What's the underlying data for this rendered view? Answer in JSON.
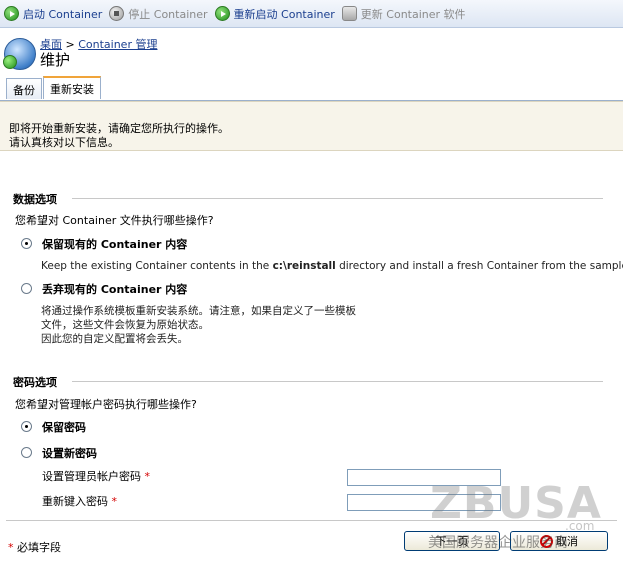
{
  "toolbar": {
    "start": "启动 Container",
    "stop": "停止 Container",
    "restart": "重新启动 Container",
    "update": "更新 Container 软件"
  },
  "breadcrumb": {
    "home": "桌面",
    "sep": ">",
    "container": "Container 管理"
  },
  "page_title": "维护",
  "tabs": {
    "backup": "备份",
    "reinstall": "重新安装"
  },
  "notice": {
    "line1": "即将开始重新安装，请确定您所执行的操作。",
    "line2": "请认真核对以下信息。"
  },
  "data_options": {
    "title": "数据选项",
    "question": "您希望对 Container 文件执行哪些操作?",
    "keep_label": "保留现有的 Container 内容",
    "keep_desc_pre": "Keep the existing Container contents in the ",
    "keep_desc_path": "c:\\reinstall",
    "keep_desc_post": " directory and install a fresh Container from the sample.",
    "discard_label": "丢弃现有的 Container 内容",
    "discard_desc1": "将通过操作系统模板重新安装系统。请注意，如果自定义了一些模板",
    "discard_desc2": "文件，这些文件会恢复为原始状态。",
    "discard_desc3": "因此您的自定义配置将会丢失。"
  },
  "password_options": {
    "title": "密码选项",
    "question": "您希望对管理帐户密码执行哪些操作?",
    "keep_label": "保留密码",
    "new_label": "设置新密码",
    "admin_pw_label": "设置管理员帐户密码",
    "retype_label": "重新键入密码",
    "required_mark": "*"
  },
  "footer": {
    "required_mark": "*",
    "required_note": "必填字段",
    "next_button": "下一页",
    "cancel_button": "取消"
  },
  "watermark": {
    "main": "ZBUSA",
    "com": ".com",
    "sub": "美国服务器企业服务商"
  }
}
